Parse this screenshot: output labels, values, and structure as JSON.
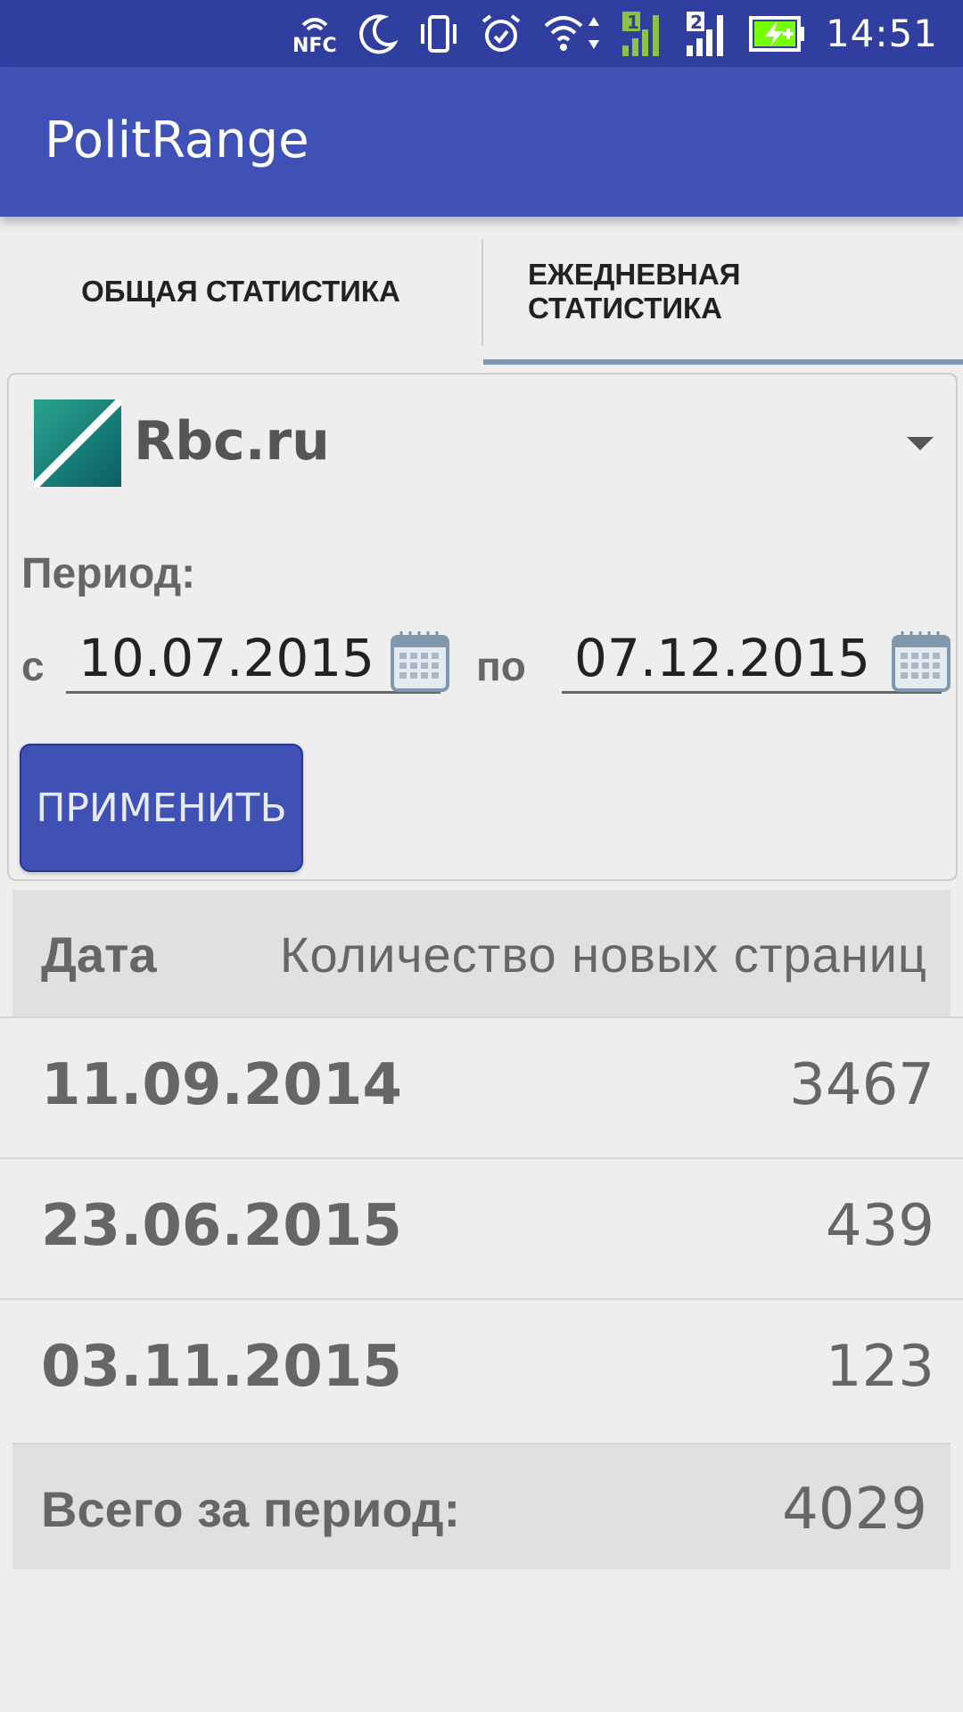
{
  "status_bar": {
    "nfc_label": "NFC",
    "sim1": "1",
    "sim2": "2",
    "time": "14:51",
    "icons": [
      "nfc-icon",
      "do-not-disturb-moon-icon",
      "vibrate-icon",
      "alarm-icon",
      "wifi-icon",
      "signal-sim1-icon",
      "signal-sim2-icon",
      "battery-charging-icon"
    ],
    "colors": {
      "background": "#303f9f",
      "sim1_signal": "#8bc34a",
      "battery": "#76ff03"
    }
  },
  "app_bar": {
    "title": "PolitRange",
    "color": "#3f51b5"
  },
  "tabs": [
    {
      "label": "ОБЩАЯ СТАТИСТИКА",
      "selected": false
    },
    {
      "label": "ЕЖЕДНЕВНАЯ СТАТИСТИКА",
      "selected": true
    }
  ],
  "filter": {
    "site": {
      "name": "Rbc.ru",
      "logo_icon": "rbc-logo"
    },
    "period_label": "Период:",
    "from_prefix": "с",
    "from_date": "10.07.2015",
    "to_prefix": "по",
    "to_date": "07.12.2015",
    "apply_label": "ПРИМЕНИТЬ"
  },
  "table": {
    "headers": {
      "date": "Дата",
      "count": "Количество новых страниц"
    },
    "rows": [
      {
        "date": "11.09.2014",
        "count": "3467"
      },
      {
        "date": "23.06.2015",
        "count": "439"
      },
      {
        "date": "03.11.2015",
        "count": "123"
      }
    ],
    "total": {
      "label": "Всего за период:",
      "value": "4029"
    }
  }
}
